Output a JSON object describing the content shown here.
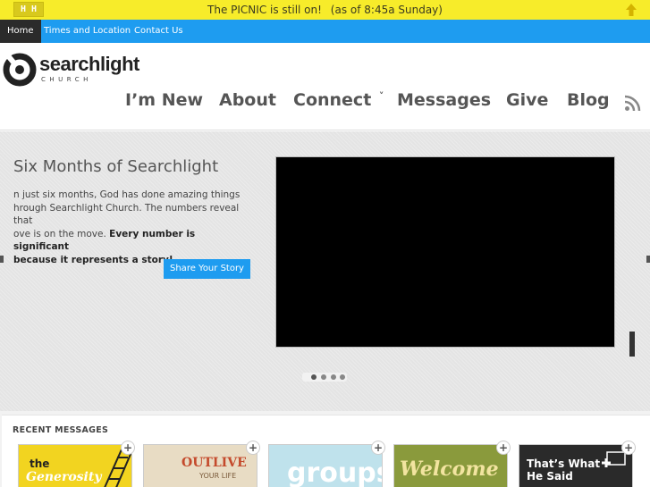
{
  "notification": {
    "logo_text": "H H",
    "message": "The PICNIC is still on!",
    "time": "(as of 8:45a Sunday)"
  },
  "topnav": {
    "items": [
      {
        "label": "Home",
        "active": true
      },
      {
        "label": "Times and Location",
        "active": false
      },
      {
        "label": "Contact Us",
        "active": false
      }
    ]
  },
  "brand": {
    "name": "searchlight",
    "subtitle": "CHURCH"
  },
  "mainnav": {
    "items": [
      {
        "label": "I’m New"
      },
      {
        "label": "About"
      },
      {
        "label": "Connect",
        "dropdown": "˅"
      },
      {
        "label": "Messages"
      },
      {
        "label": "Give"
      },
      {
        "label": "Blog"
      }
    ]
  },
  "hero": {
    "title": "Six Months of Searchlight",
    "body_lines": [
      "n just six months, God has done amazing things",
      "hrough Searchlight Church. The numbers reveal that",
      "ove is on the move."
    ],
    "body_bold_1": "Every number is significant",
    "body_bold_2": "because it represents a story!",
    "cta": "Share Your Story"
  },
  "recent": {
    "heading": "RECENT MESSAGES",
    "thumbs": [
      {
        "text_1": "the",
        "text_2": "Generosity",
        "bg": "#f2d420"
      },
      {
        "text_1": "OUTLIVE",
        "text_2": "YOUR LIFE",
        "bg": "#e8dcc4"
      },
      {
        "text_1": "groups",
        "text_2": "",
        "bg": "#bfe2ec"
      },
      {
        "text_1": "Welcome",
        "text_2": "",
        "bg": "#8a9a3c"
      },
      {
        "text_1": "That’s What",
        "text_2": "He Said",
        "bg": "#2a2a2a"
      }
    ],
    "plus": "+"
  },
  "colors": {
    "notification_bg": "#f7ec2a",
    "nav_blue": "#1e9cf0",
    "home_bg": "#2b2b2b"
  }
}
